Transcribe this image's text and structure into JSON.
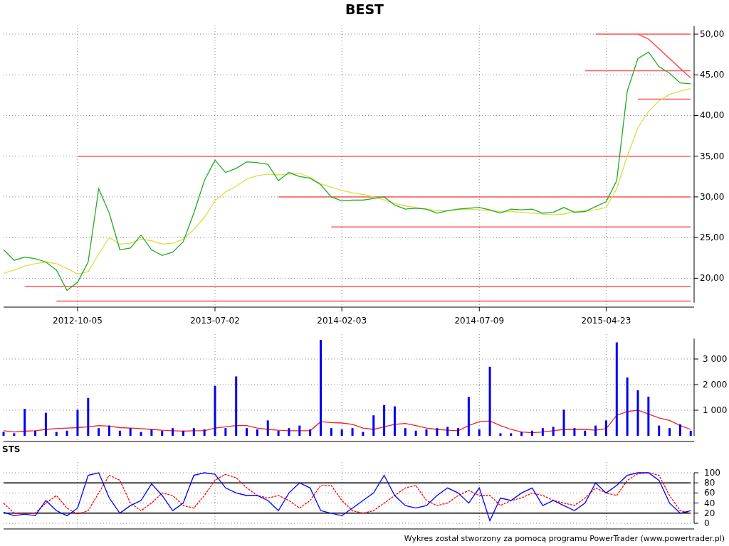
{
  "title": "BEST",
  "price_chart": {
    "chart_data": {
      "type": "line",
      "grid": true,
      "categories": [
        null,
        null,
        null,
        null,
        null,
        null,
        null,
        "2012-10-05",
        null,
        null,
        null,
        null,
        null,
        null,
        null,
        null,
        null,
        null,
        null,
        null,
        "2013-07-02",
        null,
        null,
        null,
        null,
        null,
        null,
        null,
        null,
        null,
        null,
        null,
        "2014-02-03",
        null,
        null,
        null,
        null,
        null,
        null,
        null,
        null,
        null,
        null,
        null,
        null,
        "2014-07-09",
        null,
        null,
        null,
        null,
        null,
        null,
        null,
        null,
        null,
        null,
        null,
        "2015-04-23",
        null,
        null,
        null,
        null,
        null,
        null,
        null,
        null
      ],
      "yticks": [
        {
          "value": 20,
          "label": "20,00"
        },
        {
          "value": 25,
          "label": "25,00"
        },
        {
          "value": 30,
          "label": "30,00"
        },
        {
          "value": 35,
          "label": "35,00"
        },
        {
          "value": 40,
          "label": "40,00"
        },
        {
          "value": 45,
          "label": "45,00"
        },
        {
          "value": 50,
          "label": "50,00"
        }
      ],
      "ylim": [
        17,
        51
      ],
      "series": [
        {
          "color": "#22aa22",
          "values": [
            23.5,
            22.2,
            22.6,
            22.4,
            22.0,
            21.0,
            18.5,
            19.5,
            22,
            31,
            28,
            23.5,
            23.7,
            25.3,
            23.5,
            22.8,
            23.2,
            24.5,
            28,
            32,
            34.5,
            33,
            33.5,
            34.3,
            34.2,
            34,
            32,
            33,
            32.5,
            32.3,
            31.5,
            30,
            29.5,
            29.6,
            29.6,
            29.8,
            30,
            29,
            28.5,
            28.6,
            28.5,
            28,
            28.3,
            28.5,
            28.6,
            28.7,
            28.4,
            28.0,
            28.5,
            28.4,
            28.5,
            28.0,
            28.1,
            28.7,
            28.1,
            28.2,
            28.8,
            29.4,
            32,
            43,
            47,
            47.8,
            46,
            45.2,
            44,
            43.9
          ]
        },
        {
          "color": "#dddd44",
          "values": [
            20.6,
            21,
            21.5,
            21.8,
            22,
            21.8,
            21.2,
            20.5,
            20.8,
            23,
            25,
            24.2,
            24.3,
            24.8,
            24.6,
            24.2,
            24.3,
            24.8,
            26,
            27.5,
            29.5,
            30.6,
            31.3,
            32.2,
            32.6,
            32.8,
            32.7,
            32.8,
            32.9,
            32.4,
            31.6,
            31.2,
            30.8,
            30.5,
            30.3,
            30,
            29.6,
            29.2,
            28.9,
            28.7,
            28.5,
            28.3,
            28.3,
            28.4,
            28.5,
            28.4,
            28.3,
            28.2,
            28.2,
            28.1,
            28,
            27.9,
            27.8,
            27.9,
            28.2,
            28.3,
            28.4,
            28.7,
            31,
            35,
            38.5,
            40.5,
            41.8,
            42.6,
            43,
            43.3
          ]
        },
        {
          "color": "#ff5555",
          "values": [
            null,
            null,
            null,
            null,
            null,
            null,
            null,
            null,
            null,
            null,
            null,
            null,
            null,
            null,
            null,
            null,
            null,
            null,
            null,
            null,
            null,
            null,
            null,
            null,
            null,
            null,
            null,
            null,
            null,
            null,
            null,
            null,
            null,
            null,
            null,
            null,
            null,
            null,
            null,
            null,
            null,
            null,
            null,
            null,
            null,
            null,
            null,
            null,
            null,
            null,
            null,
            null,
            null,
            null,
            null,
            null,
            50,
            50,
            50,
            50,
            50,
            50,
            50,
            50,
            50,
            50
          ]
        },
        {
          "color": "#ff5555",
          "values": [
            null,
            null,
            null,
            null,
            null,
            null,
            null,
            null,
            null,
            null,
            null,
            null,
            null,
            null,
            null,
            null,
            null,
            null,
            null,
            null,
            null,
            null,
            null,
            null,
            null,
            null,
            null,
            null,
            null,
            null,
            null,
            null,
            null,
            null,
            null,
            null,
            null,
            null,
            null,
            null,
            null,
            null,
            null,
            null,
            null,
            null,
            null,
            null,
            null,
            null,
            null,
            null,
            null,
            null,
            null,
            45.5,
            45.5,
            45.5,
            45.5,
            45.5,
            45.5,
            45.5,
            45.5,
            45.5,
            45.5,
            45.5
          ]
        },
        {
          "color": "#ff5555",
          "values": [
            null,
            null,
            null,
            null,
            null,
            null,
            null,
            null,
            null,
            null,
            null,
            null,
            null,
            null,
            null,
            null,
            null,
            null,
            null,
            null,
            null,
            null,
            null,
            null,
            null,
            null,
            null,
            null,
            null,
            null,
            null,
            null,
            null,
            null,
            null,
            null,
            null,
            null,
            null,
            null,
            null,
            null,
            null,
            null,
            null,
            null,
            null,
            null,
            null,
            null,
            null,
            null,
            null,
            null,
            null,
            null,
            null,
            null,
            null,
            null,
            42,
            42,
            42,
            42,
            42,
            42
          ]
        },
        {
          "color": "#ff5555",
          "values": [
            null,
            null,
            null,
            null,
            null,
            null,
            null,
            35,
            35,
            35,
            35,
            35,
            35,
            35,
            35,
            35,
            35,
            35,
            35,
            35,
            35,
            35,
            35,
            35,
            35,
            35,
            35,
            35,
            35,
            35,
            35,
            35,
            35,
            35,
            35,
            35,
            35,
            35,
            35,
            35,
            35,
            35,
            35,
            35,
            35,
            35,
            35,
            35,
            35,
            35,
            35,
            35,
            35,
            35,
            35,
            35,
            35,
            35,
            35,
            35,
            35,
            35,
            35,
            35,
            35,
            35
          ]
        },
        {
          "color": "#ff5555",
          "values": [
            null,
            null,
            null,
            null,
            null,
            null,
            null,
            null,
            null,
            null,
            null,
            null,
            null,
            null,
            null,
            null,
            null,
            null,
            null,
            null,
            null,
            null,
            null,
            null,
            null,
            null,
            30,
            30,
            30,
            30,
            30,
            30,
            30,
            30,
            30,
            30,
            30,
            30,
            30,
            30,
            30,
            30,
            30,
            30,
            30,
            30,
            30,
            30,
            30,
            30,
            30,
            30,
            30,
            30,
            30,
            30,
            30,
            30,
            30,
            30,
            30,
            30,
            30,
            30,
            30,
            30
          ]
        },
        {
          "color": "#ff5555",
          "values": [
            null,
            null,
            null,
            null,
            null,
            null,
            null,
            null,
            null,
            null,
            null,
            null,
            null,
            null,
            null,
            null,
            null,
            null,
            null,
            null,
            null,
            null,
            null,
            null,
            null,
            null,
            null,
            null,
            null,
            null,
            null,
            26.3,
            26.3,
            26.3,
            26.3,
            26.3,
            26.3,
            26.3,
            26.3,
            26.3,
            26.3,
            26.3,
            26.3,
            26.3,
            26.3,
            26.3,
            26.3,
            26.3,
            26.3,
            26.3,
            26.3,
            26.3,
            26.3,
            26.3,
            26.3,
            26.3,
            26.3,
            26.3,
            26.3,
            26.3,
            26.3,
            26.3,
            26.3,
            26.3,
            26.3,
            26.3
          ]
        },
        {
          "color": "#ff5555",
          "values": [
            null,
            null,
            19,
            19,
            19,
            19,
            19,
            19,
            19,
            19,
            19,
            19,
            19,
            19,
            19,
            19,
            19,
            19,
            19,
            19,
            19,
            19,
            19,
            19,
            19,
            19,
            19,
            19,
            19,
            19,
            19,
            19,
            19,
            19,
            19,
            19,
            19,
            19,
            19,
            19,
            19,
            19,
            19,
            19,
            19,
            19,
            19,
            19,
            19,
            19,
            19,
            19,
            19,
            19,
            19,
            19,
            19,
            19,
            19,
            19,
            19,
            19,
            19,
            19,
            19,
            19
          ]
        },
        {
          "color": "#ff5555",
          "values": [
            null,
            null,
            null,
            null,
            null,
            17.2,
            17.2,
            17.2,
            17.2,
            17.2,
            17.2,
            17.2,
            17.2,
            17.2,
            17.2,
            17.2,
            17.2,
            17.2,
            17.2,
            17.2,
            17.2,
            17.2,
            17.2,
            17.2,
            17.2,
            17.2,
            17.2,
            17.2,
            17.2,
            17.2,
            17.2,
            17.2,
            17.2,
            17.2,
            17.2,
            17.2,
            17.2,
            17.2,
            17.2,
            17.2,
            17.2,
            17.2,
            17.2,
            17.2,
            17.2,
            17.2,
            17.2,
            17.2,
            17.2,
            17.2,
            17.2,
            17.2,
            17.2,
            17.2,
            17.2,
            17.2,
            17.2,
            17.2,
            17.2,
            17.2,
            17.2,
            17.2,
            17.2,
            17.2,
            17.2,
            17.2
          ]
        },
        {
          "color": "#ff5555",
          "values": [
            null,
            null,
            null,
            null,
            null,
            null,
            null,
            null,
            null,
            null,
            null,
            null,
            null,
            null,
            null,
            null,
            null,
            null,
            null,
            null,
            null,
            null,
            null,
            null,
            null,
            null,
            null,
            null,
            null,
            null,
            null,
            null,
            null,
            null,
            null,
            null,
            null,
            null,
            null,
            null,
            null,
            null,
            null,
            null,
            null,
            null,
            null,
            null,
            null,
            null,
            null,
            null,
            null,
            null,
            null,
            null,
            null,
            null,
            null,
            null,
            50,
            49.4,
            48.2,
            47,
            45.8,
            44.6
          ]
        }
      ]
    }
  },
  "volume_chart": {
    "chart_data": {
      "type": "bar",
      "grid": true,
      "categories": [
        null,
        null,
        null,
        null,
        null,
        null,
        null,
        null,
        null,
        null,
        null,
        null,
        null,
        null,
        null,
        null,
        null,
        null,
        null,
        null,
        null,
        null,
        null,
        null,
        null,
        null,
        null,
        null,
        null,
        null,
        null,
        null,
        null,
        null,
        null,
        null,
        null,
        null,
        null,
        null,
        null,
        null,
        null,
        null,
        null,
        null,
        null,
        null,
        null,
        null,
        null,
        null,
        null,
        null,
        null,
        null,
        null,
        null,
        null,
        null,
        null,
        null,
        null,
        null,
        null,
        null
      ],
      "yticks": [
        {
          "value": 1000,
          "label": "1 000"
        },
        {
          "value": 2000,
          "label": "2 000"
        },
        {
          "value": 3000,
          "label": "3 000"
        }
      ],
      "ylim": [
        0,
        3800
      ],
      "series": [
        {
          "color": "#0000ee",
          "values": [
            150,
            100,
            1050,
            200,
            900,
            150,
            200,
            1020,
            1480,
            300,
            400,
            200,
            300,
            150,
            250,
            200,
            300,
            200,
            300,
            250,
            1950,
            300,
            2320,
            300,
            250,
            600,
            200,
            300,
            400,
            250,
            3750,
            300,
            250,
            300,
            150,
            800,
            1200,
            1150,
            300,
            200,
            250,
            300,
            350,
            300,
            1520,
            250,
            2700,
            100,
            100,
            150,
            200,
            300,
            350,
            1020,
            300,
            200,
            400,
            600,
            3650,
            2280,
            1780,
            1530,
            400,
            300,
            450,
            200
          ]
        },
        {
          "type": "line",
          "color": "#ee2222",
          "values": [
            200,
            150,
            180,
            200,
            250,
            280,
            300,
            320,
            350,
            400,
            380,
            320,
            300,
            280,
            250,
            220,
            200,
            180,
            200,
            200,
            300,
            350,
            400,
            400,
            300,
            250,
            220,
            200,
            200,
            200,
            550,
            520,
            500,
            450,
            300,
            250,
            350,
            450,
            480,
            400,
            300,
            250,
            220,
            200,
            400,
            550,
            580,
            400,
            250,
            150,
            120,
            150,
            200,
            250,
            250,
            250,
            220,
            280,
            800,
            950,
            1000,
            850,
            700,
            600,
            400,
            250
          ]
        }
      ]
    }
  },
  "sts_chart": {
    "label": "STS",
    "chart_data": {
      "type": "line",
      "grid": true,
      "categories": [
        null,
        null,
        null,
        null,
        null,
        null,
        null,
        null,
        null,
        null,
        null,
        null,
        null,
        null,
        null,
        null,
        null,
        null,
        null,
        null,
        null,
        null,
        null,
        null,
        null,
        null,
        null,
        null,
        null,
        null,
        null,
        null,
        null,
        null,
        null,
        null,
        null,
        null,
        null,
        null,
        null,
        null,
        null,
        null,
        null,
        null,
        null,
        null,
        null,
        null,
        null,
        null,
        null,
        null,
        null,
        null,
        null,
        null,
        null,
        null,
        null,
        null,
        null,
        null,
        null,
        null
      ],
      "yticks": [
        0,
        20,
        40,
        60,
        80,
        100
      ],
      "ylim": [
        0,
        100
      ],
      "series": [
        {
          "color": "#0000ff",
          "values": [
            22,
            15,
            18,
            15,
            45,
            25,
            15,
            30,
            95,
            100,
            50,
            20,
            35,
            45,
            78,
            55,
            25,
            40,
            95,
            100,
            97,
            70,
            60,
            55,
            55,
            45,
            25,
            60,
            80,
            70,
            25,
            20,
            15,
            30,
            45,
            60,
            95,
            55,
            35,
            30,
            35,
            55,
            70,
            60,
            40,
            70,
            5,
            50,
            45,
            60,
            70,
            35,
            45,
            35,
            25,
            40,
            80,
            60,
            75,
            95,
            100,
            100,
            85,
            40,
            20,
            25
          ]
        },
        {
          "color": "#ff0000",
          "line_style": "dashed",
          "values": [
            40,
            20,
            18,
            20,
            40,
            55,
            30,
            18,
            25,
            60,
            95,
            85,
            40,
            25,
            40,
            60,
            55,
            35,
            30,
            55,
            85,
            97,
            90,
            70,
            55,
            50,
            55,
            45,
            30,
            45,
            75,
            75,
            45,
            25,
            20,
            25,
            40,
            55,
            70,
            75,
            45,
            35,
            40,
            55,
            65,
            55,
            55,
            35,
            45,
            50,
            60,
            55,
            45,
            40,
            35,
            50,
            70,
            60,
            55,
            85,
            98,
            100,
            95,
            55,
            25,
            20
          ]
        },
        {
          "color": "#000000",
          "values": [
            20,
            20,
            20,
            20,
            20,
            20,
            20,
            20,
            20,
            20,
            20,
            20,
            20,
            20,
            20,
            20,
            20,
            20,
            20,
            20,
            20,
            20,
            20,
            20,
            20,
            20,
            20,
            20,
            20,
            20,
            20,
            20,
            20,
            20,
            20,
            20,
            20,
            20,
            20,
            20,
            20,
            20,
            20,
            20,
            20,
            20,
            20,
            20,
            20,
            20,
            20,
            20,
            20,
            20,
            20,
            20,
            20,
            20,
            20,
            20,
            20,
            20,
            20,
            20,
            20,
            20
          ]
        },
        {
          "color": "#000000",
          "values": [
            80,
            80,
            80,
            80,
            80,
            80,
            80,
            80,
            80,
            80,
            80,
            80,
            80,
            80,
            80,
            80,
            80,
            80,
            80,
            80,
            80,
            80,
            80,
            80,
            80,
            80,
            80,
            80,
            80,
            80,
            80,
            80,
            80,
            80,
            80,
            80,
            80,
            80,
            80,
            80,
            80,
            80,
            80,
            80,
            80,
            80,
            80,
            80,
            80,
            80,
            80,
            80,
            80,
            80,
            80,
            80,
            80,
            80,
            80,
            80,
            80,
            80,
            80,
            80,
            80,
            80
          ]
        }
      ]
    }
  },
  "footer": "Wykres został stworzony za pomocą programu PowerTrader (www.powertrader.pl)"
}
